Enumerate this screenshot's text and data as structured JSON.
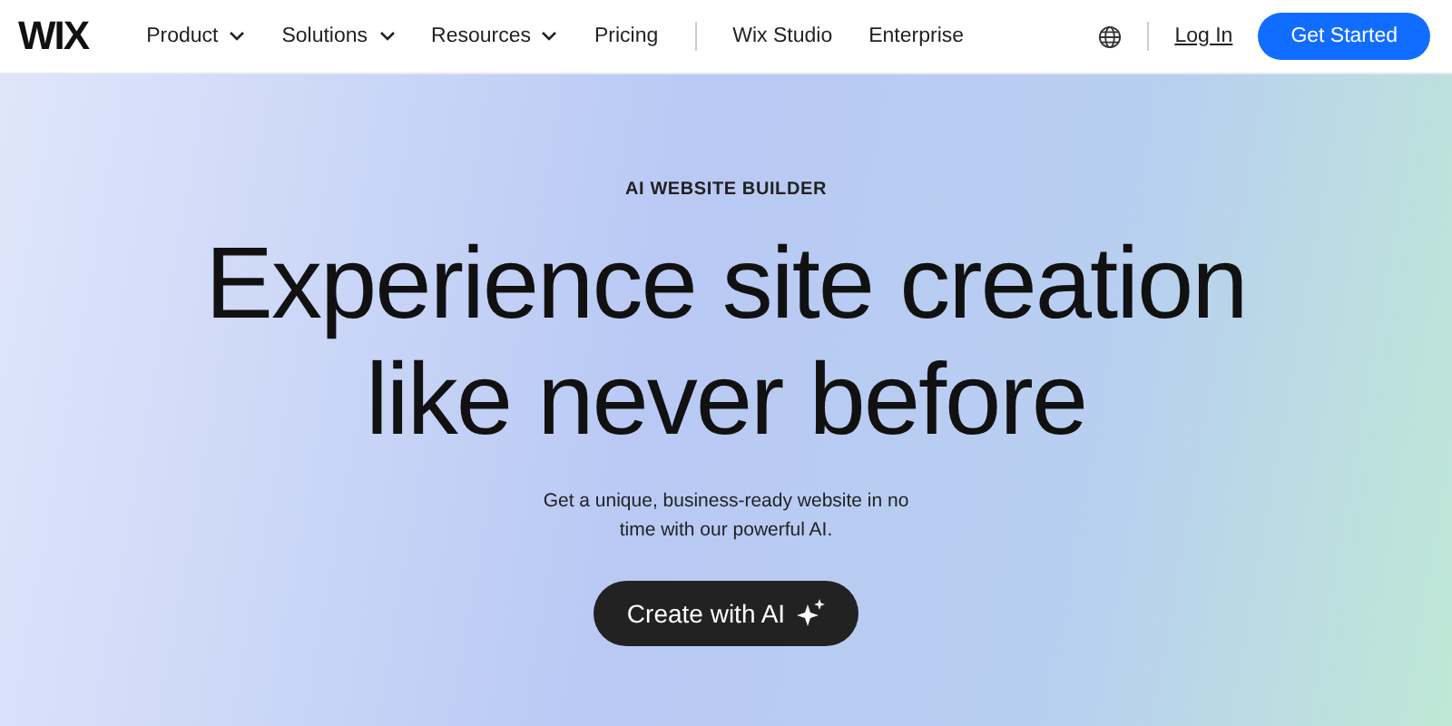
{
  "logo": "WIX",
  "nav": [
    {
      "label": "Product",
      "kind": "menu"
    },
    {
      "label": "Solutions",
      "kind": "menu"
    },
    {
      "label": "Resources",
      "kind": "menu"
    },
    {
      "label": "Pricing",
      "kind": "link"
    },
    {
      "label": "Wix Studio",
      "kind": "link",
      "divider_before": true
    },
    {
      "label": "Enterprise",
      "kind": "link"
    }
  ],
  "login": "Log In",
  "cta": "Get Started",
  "hero": {
    "eyebrow": "AI WEBSITE BUILDER",
    "headline": [
      "Experience site creation",
      "like never before"
    ],
    "subtext": "Get a unique, business-ready website in no time with our powerful AI.",
    "button": "Create with AI"
  }
}
